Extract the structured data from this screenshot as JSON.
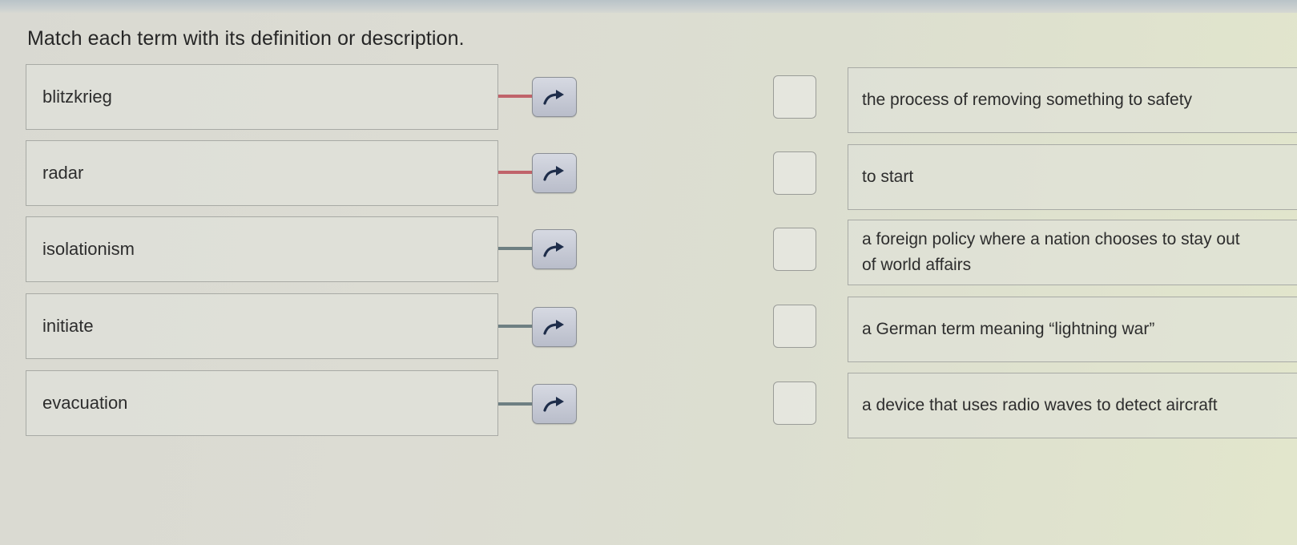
{
  "instructions": "Match each term with its definition or description.",
  "terms": [
    {
      "label": "blitzkrieg",
      "connector_color": "#c0636a"
    },
    {
      "label": "radar",
      "connector_color": "#c0636a"
    },
    {
      "label": "isolationism",
      "connector_color": "#6e7f82"
    },
    {
      "label": "initiate",
      "connector_color": "#6e7f82"
    },
    {
      "label": "evacuation",
      "connector_color": "#6e7f82"
    }
  ],
  "definitions": [
    {
      "text": "the process of removing something to safety"
    },
    {
      "text": "to start"
    },
    {
      "text": "a foreign policy where a nation chooses to stay out of world affairs"
    },
    {
      "text": "a German term meaning “lightning war”"
    },
    {
      "text": "a device that uses radio waves to detect aircraft"
    }
  ],
  "icons": {
    "arrow_button": "curved-arrow-right-icon"
  }
}
